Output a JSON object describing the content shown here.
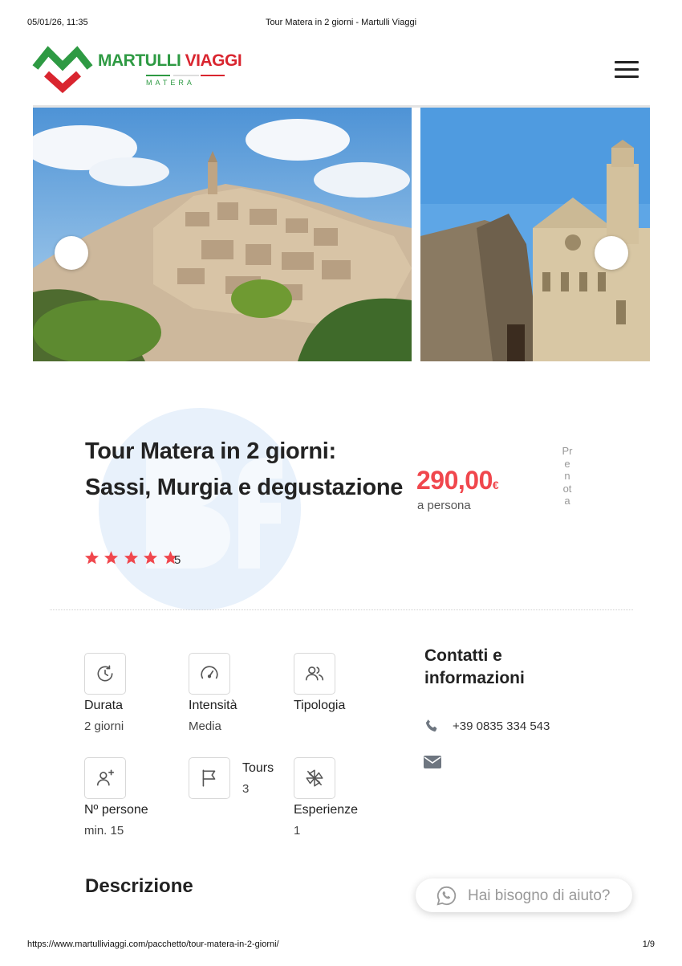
{
  "print": {
    "datetime": "05/01/26, 11:35",
    "doc_title": "Tour Matera in 2 giorni - Martulli Viaggi",
    "url": "https://www.martulliviaggi.com/pacchetto/tour-matera-in-2-giorni/",
    "page": "1/9"
  },
  "brand": {
    "name_part1": "MARTULLI",
    "name_part2": "VIAGGI",
    "subtitle": "MATERA",
    "green": "#2e9a43",
    "red": "#d9252f"
  },
  "product": {
    "title": "Tour Matera in 2 giorni: Sassi, Murgia e degustazione",
    "rating": 5,
    "rating_label": "5",
    "price": "290,00",
    "currency": "€",
    "price_unit": "a persona",
    "book_label": "Prenota",
    "accent": "#f0474d"
  },
  "features": [
    {
      "icon": "clock-icon",
      "label": "Durata",
      "value": "2 giorni"
    },
    {
      "icon": "gauge-icon",
      "label": "Intensità",
      "value": "Media"
    },
    {
      "icon": "users-icon",
      "label": "Tipologia",
      "value": ""
    },
    {
      "icon": "user-plus-icon",
      "label": "Nº persone",
      "value": "min. 15"
    },
    {
      "icon": "flag-icon",
      "label": "Tours",
      "value": "3"
    },
    {
      "icon": "pinwheel-icon",
      "label": "Esperienze",
      "value": "1"
    }
  ],
  "contacts": {
    "title": "Contatti e informazioni",
    "phone": "+39 0835 334 543"
  },
  "description": {
    "title": "Descrizione"
  },
  "help": {
    "label": "Hai bisogno di aiuto?"
  }
}
